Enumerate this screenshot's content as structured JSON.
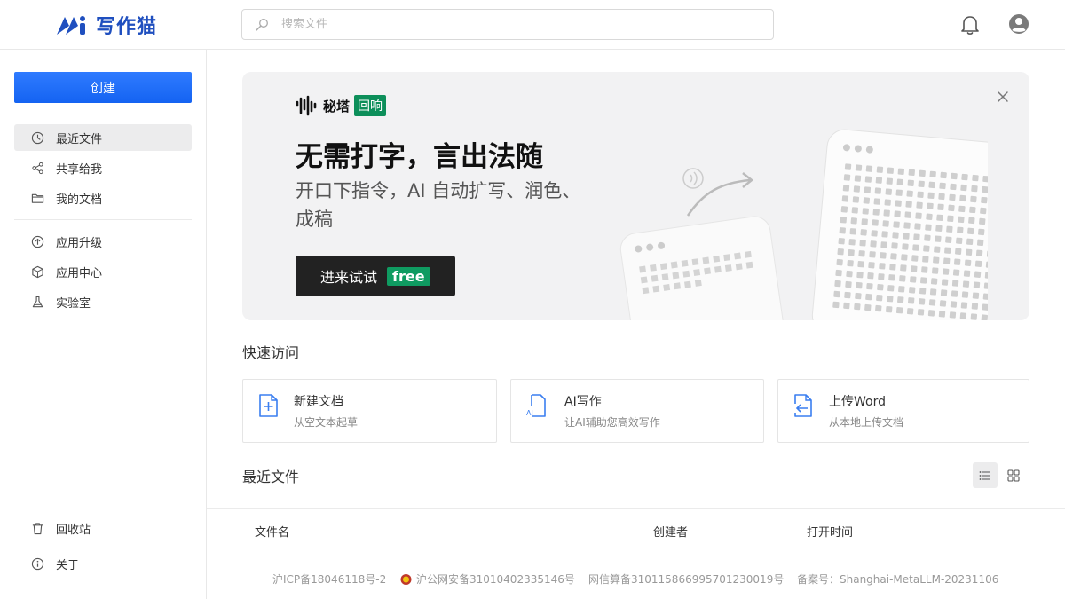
{
  "header": {
    "logo_text": "写作猫",
    "search_placeholder": "搜索文件",
    "brand_color": "#1f4fbf"
  },
  "sidebar": {
    "create_label": "创建",
    "items": [
      {
        "label": "最近文件",
        "icon": "clock-icon",
        "active": true
      },
      {
        "label": "共享给我",
        "icon": "share-icon"
      },
      {
        "label": "我的文档",
        "icon": "folder-icon"
      },
      {
        "label": "应用升级",
        "icon": "upgrade-icon"
      },
      {
        "label": "应用中心",
        "icon": "cube-icon"
      },
      {
        "label": "实验室",
        "icon": "flask-icon"
      }
    ],
    "bottom_items": [
      {
        "label": "回收站",
        "icon": "trash-icon"
      },
      {
        "label": "关于",
        "icon": "info-icon"
      }
    ]
  },
  "banner": {
    "brand_name": "秘塔",
    "brand_tag": "回响",
    "headline": "无需打字，言出法随",
    "subline": "开口下指令，AI 自动扩写、润色、成稿",
    "button_label": "进来试试",
    "button_badge": "free"
  },
  "quick_access": {
    "title": "快速访问",
    "cards": [
      {
        "title": "新建文档",
        "subtitle": "从空文本起草",
        "icon": "new-doc-icon"
      },
      {
        "title": "AI写作",
        "subtitle": "让AI辅助您高效写作",
        "icon": "ai-doc-icon"
      },
      {
        "title": "上传Word",
        "subtitle": "从本地上传文档",
        "icon": "upload-doc-icon"
      }
    ]
  },
  "recent": {
    "title": "最近文件",
    "columns": [
      "文件名",
      "创建者",
      "打开时间"
    ]
  },
  "footer": {
    "icp": "沪ICP备18046118号-2",
    "police": "沪公网安备31010402335146号",
    "algo": "网信算备310115866995701230019号",
    "record": "备案号：Shanghai-MetaLLM-20231106"
  }
}
